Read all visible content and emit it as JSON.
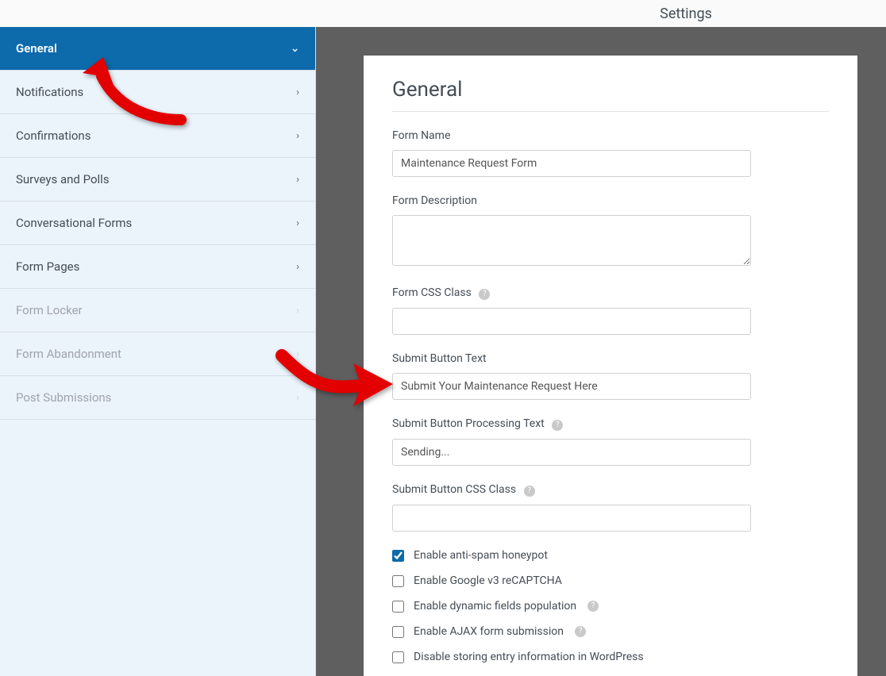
{
  "header": {
    "title": "Settings"
  },
  "sidebar": {
    "items": [
      {
        "label": "General",
        "active": true
      },
      {
        "label": "Notifications"
      },
      {
        "label": "Confirmations"
      },
      {
        "label": "Surveys and Polls"
      },
      {
        "label": "Conversational Forms"
      },
      {
        "label": "Form Pages"
      },
      {
        "label": "Form Locker",
        "disabled": true
      },
      {
        "label": "Form Abandonment",
        "disabled": true
      },
      {
        "label": "Post Submissions",
        "disabled": true
      }
    ]
  },
  "panel": {
    "heading": "General",
    "fields": {
      "form_name": {
        "label": "Form Name",
        "value": "Maintenance Request Form"
      },
      "form_description": {
        "label": "Form Description",
        "value": ""
      },
      "form_css_class": {
        "label": "Form CSS Class",
        "value": "",
        "help": true
      },
      "submit_button_text": {
        "label": "Submit Button Text",
        "value": "Submit Your Maintenance Request Here"
      },
      "submit_button_processing": {
        "label": "Submit Button Processing Text",
        "value": "Sending...",
        "help": true
      },
      "submit_button_css_class": {
        "label": "Submit Button CSS Class",
        "value": "",
        "help": true
      }
    },
    "checkboxes": [
      {
        "label": "Enable anti-spam honeypot",
        "checked": true,
        "help": false
      },
      {
        "label": "Enable Google v3 reCAPTCHA",
        "checked": false,
        "help": false
      },
      {
        "label": "Enable dynamic fields population",
        "checked": false,
        "help": true
      },
      {
        "label": "Enable AJAX form submission",
        "checked": false,
        "help": true
      },
      {
        "label": "Disable storing entry information in WordPress",
        "checked": false,
        "help": false
      }
    ]
  }
}
